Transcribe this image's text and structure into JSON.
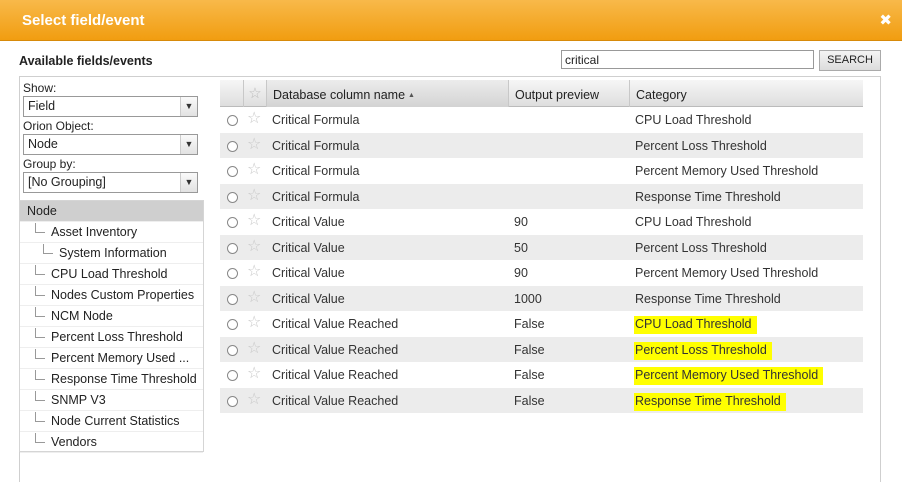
{
  "dialog": {
    "title": "Select field/event",
    "close_icon": "close-icon"
  },
  "available_label": "Available fields/events",
  "search": {
    "value": "critical",
    "button_label": "SEARCH"
  },
  "filters": {
    "show_label": "Show:",
    "show_value": "Field",
    "object_label": "Orion Object:",
    "object_value": "Node",
    "group_label": "Group by:",
    "group_value": "[No Grouping]"
  },
  "tree": [
    {
      "label": "Node",
      "level": 0
    },
    {
      "label": "Asset Inventory",
      "level": 1
    },
    {
      "label": "System Information",
      "level": 2
    },
    {
      "label": "CPU Load Threshold",
      "level": 1
    },
    {
      "label": "Nodes Custom Properties",
      "level": 1
    },
    {
      "label": "NCM Node",
      "level": 1
    },
    {
      "label": "Percent Loss Threshold",
      "level": 1
    },
    {
      "label": "Percent Memory Used ...",
      "level": 1
    },
    {
      "label": "Response Time Threshold",
      "level": 1
    },
    {
      "label": "SNMP V3",
      "level": 1
    },
    {
      "label": "Node Current Statistics",
      "level": 1
    },
    {
      "label": "Vendors",
      "level": 1
    }
  ],
  "grid": {
    "columns": [
      "Database column name",
      "Output preview",
      "Category"
    ],
    "highlight_color": "#ffff00",
    "rows": [
      {
        "name": "Critical Formula",
        "preview": "",
        "category": "CPU Load Threshold",
        "highlight": false
      },
      {
        "name": "Critical Formula",
        "preview": "",
        "category": "Percent Loss Threshold",
        "highlight": false
      },
      {
        "name": "Critical Formula",
        "preview": "",
        "category": "Percent Memory Used Threshold",
        "highlight": false
      },
      {
        "name": "Critical Formula",
        "preview": "",
        "category": "Response Time Threshold",
        "highlight": false
      },
      {
        "name": "Critical Value",
        "preview": "90",
        "category": "CPU Load Threshold",
        "highlight": false
      },
      {
        "name": "Critical Value",
        "preview": "50",
        "category": "Percent Loss Threshold",
        "highlight": false
      },
      {
        "name": "Critical Value",
        "preview": "90",
        "category": "Percent Memory Used Threshold",
        "highlight": false
      },
      {
        "name": "Critical Value",
        "preview": "1000",
        "category": "Response Time Threshold",
        "highlight": false
      },
      {
        "name": "Critical Value Reached",
        "preview": "False",
        "category": "CPU Load Threshold",
        "highlight": true
      },
      {
        "name": "Critical Value Reached",
        "preview": "False",
        "category": "Percent Loss Threshold",
        "highlight": true
      },
      {
        "name": "Critical Value Reached",
        "preview": "False",
        "category": "Percent Memory Used Threshold",
        "highlight": true
      },
      {
        "name": "Critical Value Reached",
        "preview": "False",
        "category": "Response Time Threshold",
        "highlight": true
      }
    ]
  }
}
